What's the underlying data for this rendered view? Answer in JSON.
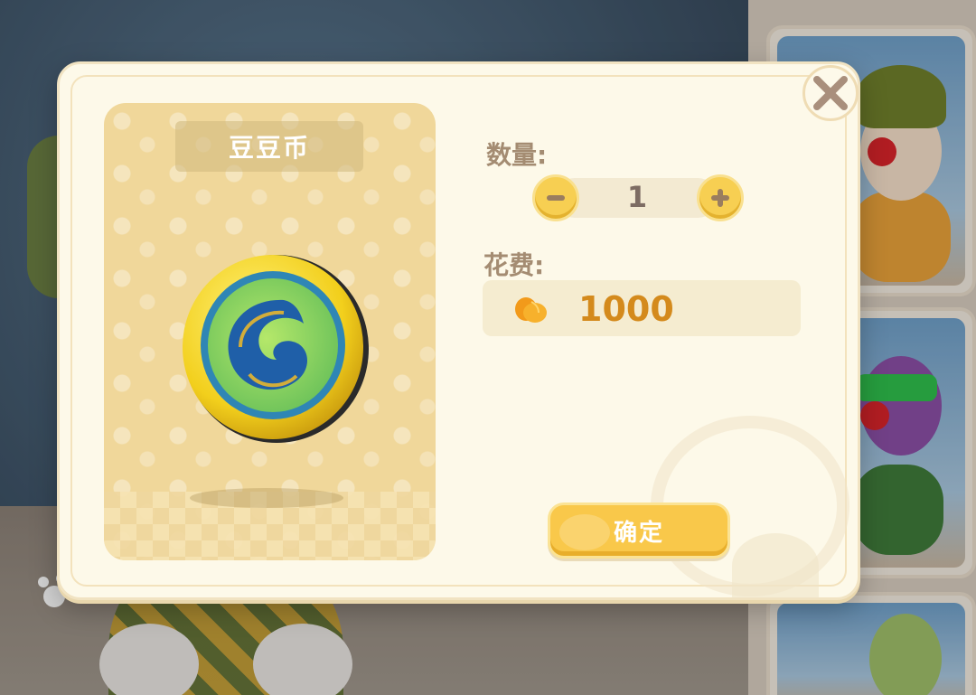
{
  "dialog": {
    "item_name": "豆豆币",
    "quantity_label": "数量:",
    "quantity_value": "1",
    "cost_label": "花费:",
    "cost_value": "1000",
    "confirm_label": "确定"
  },
  "icons": {
    "close": "close-icon",
    "minus": "minus-icon",
    "plus": "plus-icon",
    "currency": "orange-currency-icon",
    "item": "doudou-coin-icon"
  },
  "colors": {
    "accent_yellow": "#f9c84a",
    "cost_orange": "#d48a1c",
    "label_brown": "#a48c72",
    "dialog_bg": "#fdf9e9"
  }
}
